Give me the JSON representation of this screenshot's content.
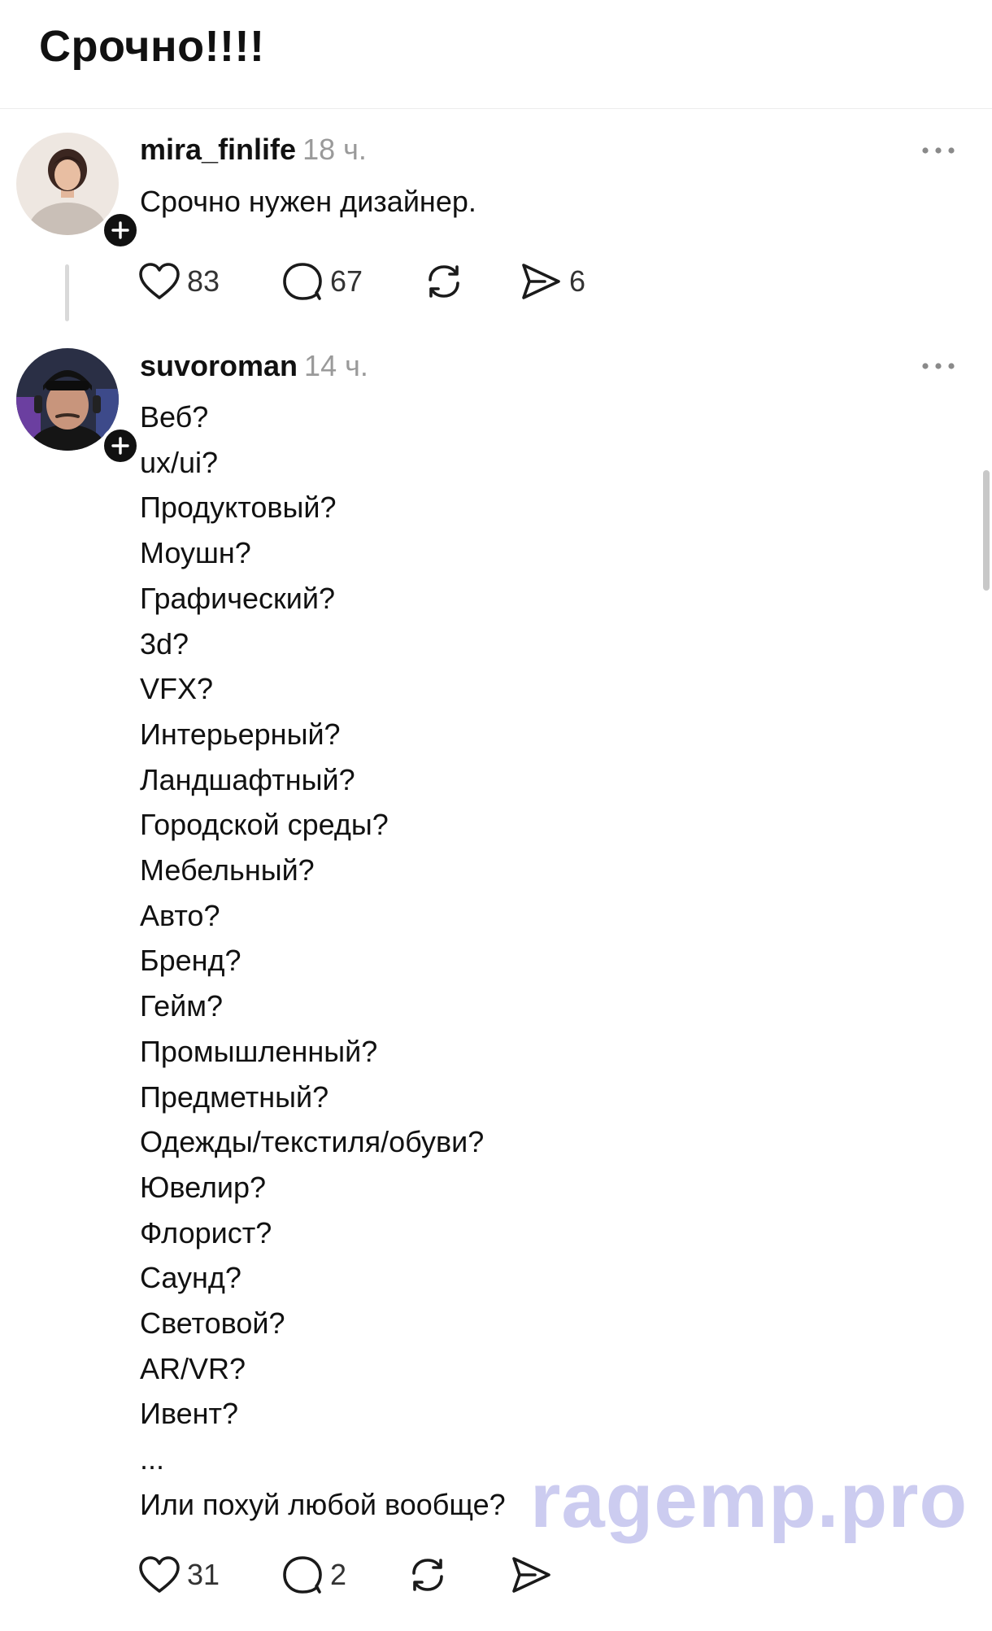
{
  "page": {
    "title": "Срочно!!!!"
  },
  "posts": [
    {
      "username": "mira_finlife",
      "time": "18 ч.",
      "text": "Срочно нужен дизайнер.",
      "likes": "83",
      "comments": "67",
      "shares": "6"
    },
    {
      "username": "suvoroman",
      "time": "14 ч.",
      "lines": [
        "Веб?",
        "ux/ui?",
        "Продуктовый?",
        "Моушн?",
        "Графический?",
        "3d?",
        "VFX?",
        "Интерьерный?",
        "Ландшафтный?",
        "Городской среды?",
        "Мебельный?",
        "Авто?",
        "Бренд?",
        "Гейм?",
        "Промышленный?",
        "Предметный?",
        "Одежды/текстиля/обуви?",
        "Ювелир?",
        "Флорист?",
        "Саунд?",
        "Световой?",
        "AR/VR?",
        "Ивент?",
        "...",
        "Или похуй любой вообще?"
      ],
      "likes": "31",
      "comments": "2"
    }
  ],
  "watermark": "ragemp.pro",
  "icons": [
    "heart-icon",
    "comment-icon",
    "repost-icon",
    "share-icon",
    "more-icon",
    "follow-plus-icon"
  ]
}
